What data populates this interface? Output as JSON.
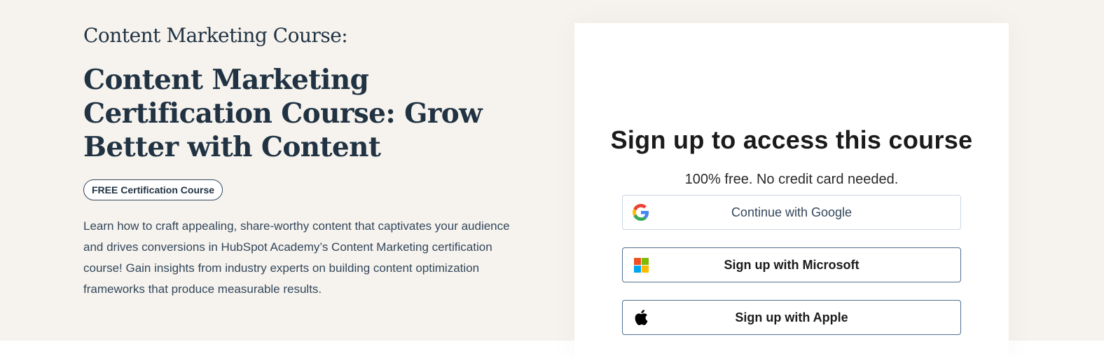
{
  "course": {
    "eyebrow": "Content Marketing Course:",
    "title": "Content Marketing Certification Course: Grow Better with Content",
    "badge": "FREE Certification Course",
    "description": "Learn how to craft appealing, share-worthy content that captivates your audience and drives conversions in HubSpot Academy’s Content Marketing certification course! Gain insights from industry experts on building content optimization frameworks that produce measurable results."
  },
  "signup": {
    "title": "Sign up to access this course",
    "subtitle": "100% free. No credit card needed.",
    "google_label": "Continue with Google",
    "microsoft_label": "Sign up with Microsoft",
    "apple_label": "Sign up with Apple",
    "icons": {
      "google": "google-icon",
      "microsoft": "microsoft-icon",
      "apple": "apple-icon"
    }
  },
  "colors": {
    "background": "#f6f3ee",
    "heading": "#213343",
    "microsoft_red": "#f25022",
    "microsoft_green": "#7fba00",
    "microsoft_blue": "#00a4ef",
    "microsoft_yellow": "#ffb900"
  }
}
